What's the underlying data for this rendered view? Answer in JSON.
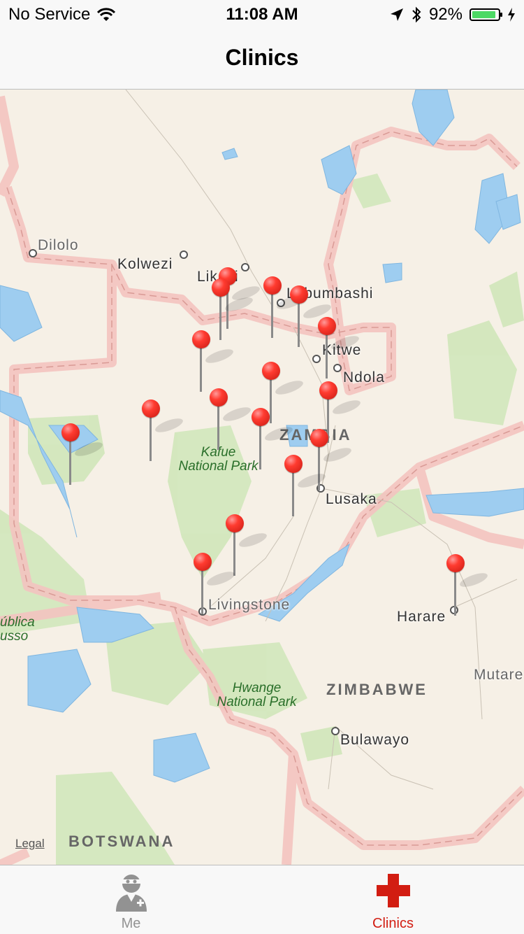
{
  "status_bar": {
    "carrier": "No Service",
    "time": "11:08 AM",
    "battery_percent": "92%",
    "battery_level": 0.92,
    "battery_color": "#4cd964"
  },
  "nav": {
    "title": "Clinics"
  },
  "map": {
    "cities": {
      "dilolo": "Dilolo",
      "kolwezi": "Kolwezi",
      "likasi": "Likasi",
      "lubumbashi": "Lubumbashi",
      "kitwe": "Kitwe",
      "ndola": "Ndola",
      "lusaka": "Lusaka",
      "livingstone": "Livingstone",
      "harare": "Harare",
      "mutare": "Mutare",
      "bulawayo": "Bulawayo",
      "republica": "ública",
      "russo": "usso"
    },
    "countries": {
      "zambia": "ZAMBIA",
      "zimbabwe": "ZIMBABWE",
      "botswana": "BOTSWANA"
    },
    "parks": {
      "kafue": "Kafue\nNational Park",
      "hwange": "Hwange\nNational Park"
    },
    "legal": "Legal",
    "pin_color": "#ff3b30"
  },
  "tab_bar": {
    "tabs": [
      {
        "label": "Me",
        "icon": "doctor-icon",
        "selected": false
      },
      {
        "label": "Clinics",
        "icon": "red-cross-icon",
        "selected": true
      }
    ],
    "selected_color": "#d21d12",
    "unselected_color": "#929292"
  }
}
